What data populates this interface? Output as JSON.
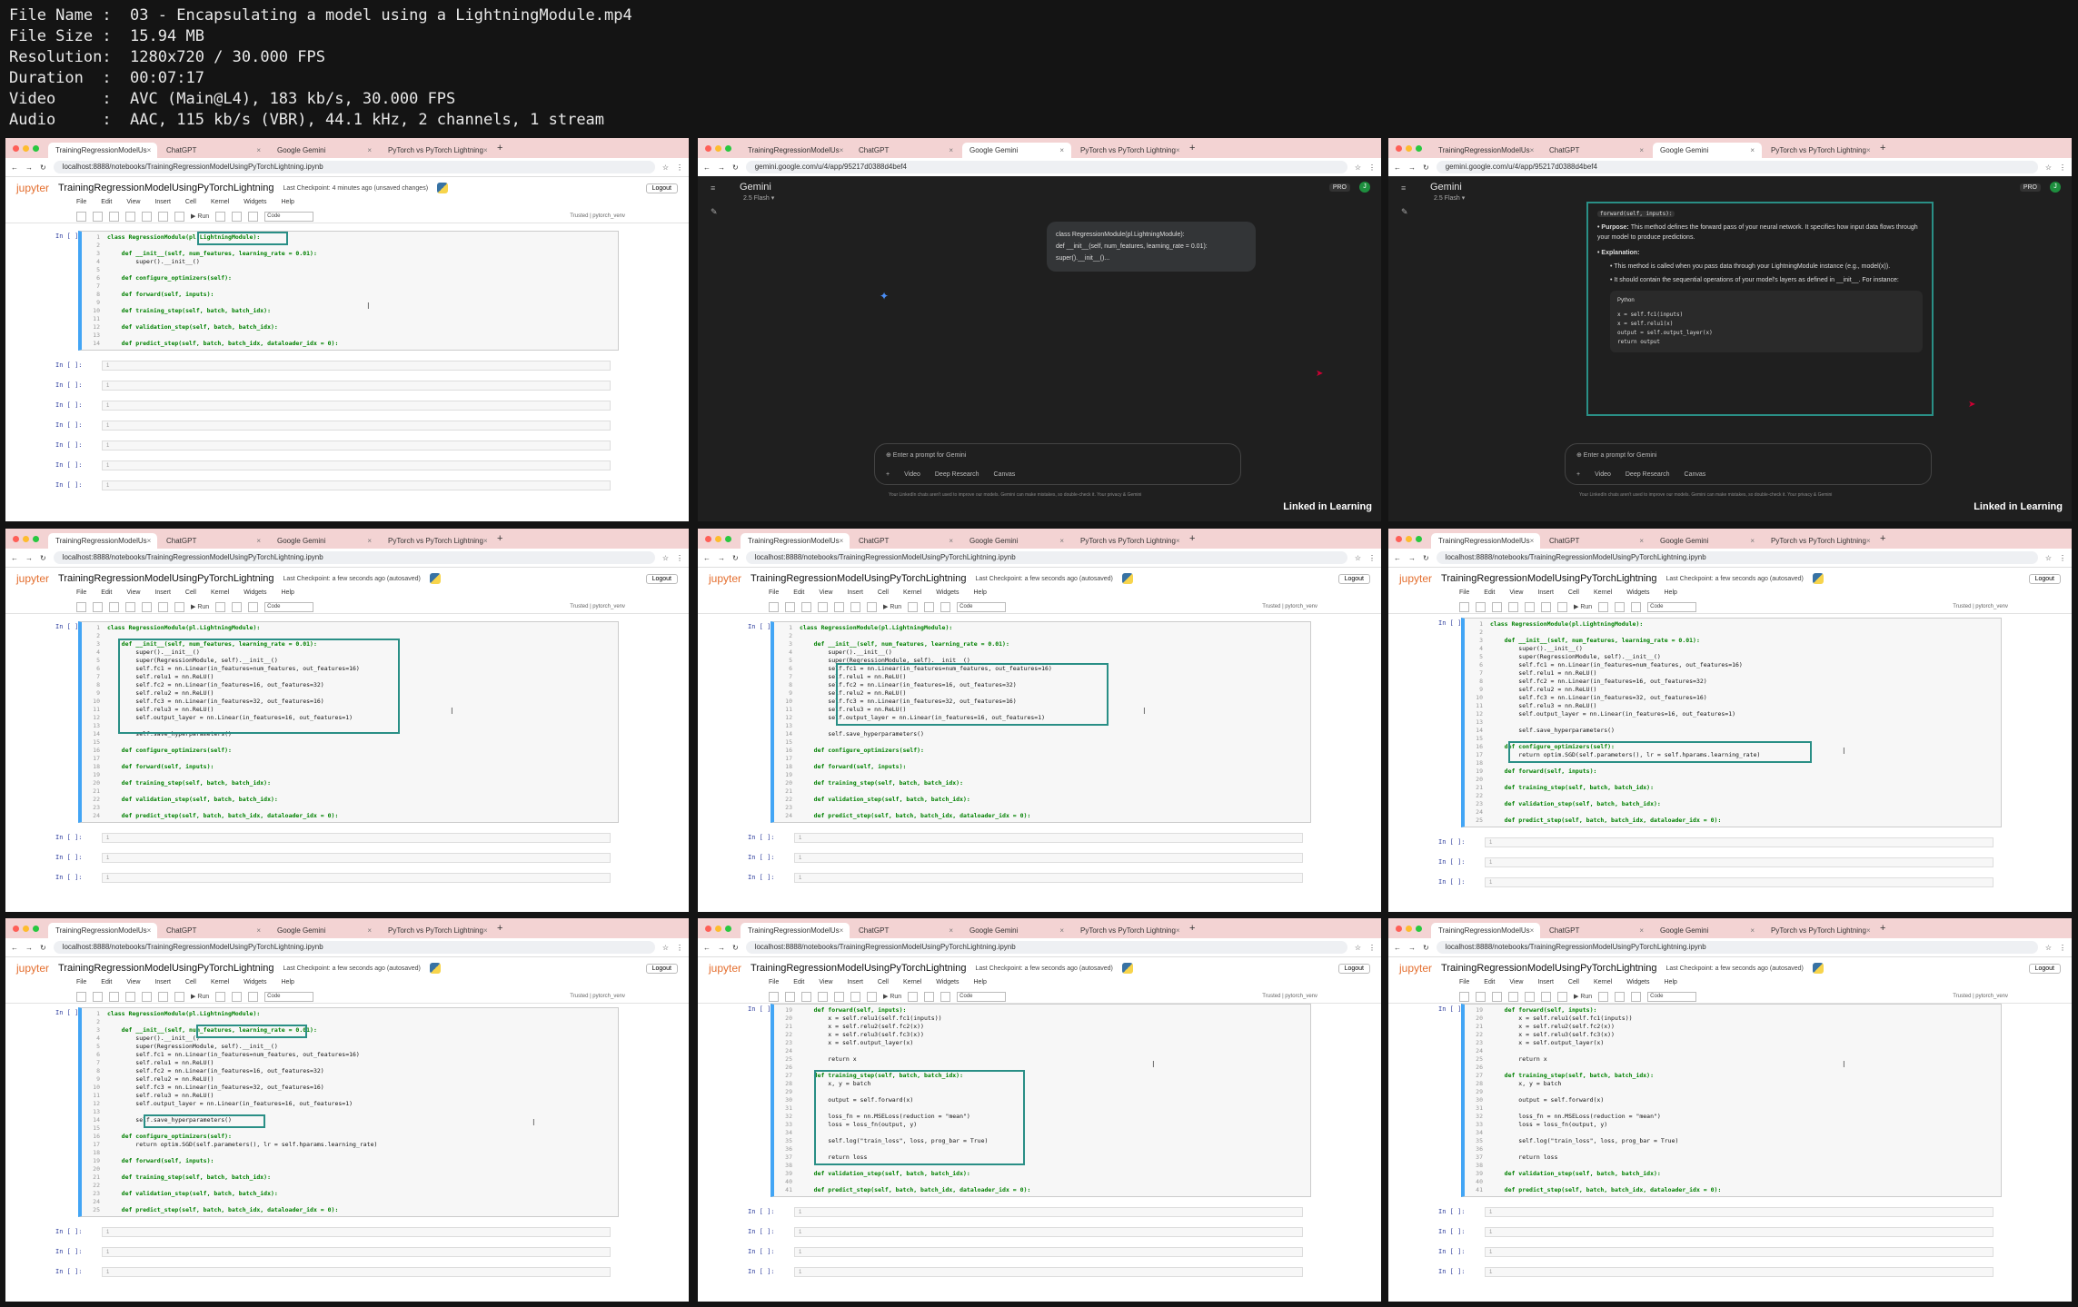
{
  "metadata": [
    {
      "label": "File Name",
      "value": "03 - Encapsulating a model using a LightningModule.mp4"
    },
    {
      "label": "File Size",
      "value": "15.94 MB"
    },
    {
      "label": "Resolution",
      "value": "1280x720 / 30.000 FPS"
    },
    {
      "label": "Duration",
      "value": "00:07:17"
    },
    {
      "label": "Video",
      "value": "AVC (Main@L4), 183 kb/s, 30.000 FPS"
    },
    {
      "label": "Audio",
      "value": "AAC, 115 kb/s (VBR), 44.1 kHz, 2 channels, 1 stream"
    }
  ],
  "browser": {
    "tabs": [
      "TrainingRegressionModelUs",
      "ChatGPT",
      "Google Gemini",
      "PyTorch vs PyTorch Lightning"
    ],
    "jupyter_url": "localhost:8888/notebooks/TrainingRegressionModelUsingPyTorchLightning.ipynb",
    "gemini_url": "gemini.google.com/u/4/app/95217d0388d4bef4"
  },
  "jupyter": {
    "logo": "jupyter",
    "notebook_title": "TrainingRegressionModelUsingPyTorchLightning",
    "checkpoint_first": "Last Checkpoint: 4 minutes ago  (unsaved changes)",
    "checkpoint_later": "Last Checkpoint: a few seconds ago  (autosaved)",
    "logout": "Logout",
    "menu": [
      "File",
      "Edit",
      "View",
      "Insert",
      "Cell",
      "Kernel",
      "Widgets",
      "Help"
    ],
    "run": "Run",
    "celltype": "Code",
    "trusted": "Trusted",
    "kernel": "pytorch_venv",
    "in_prompt": "In [ ]:"
  },
  "gemini": {
    "title": "Gemini",
    "model": "2.5 Flash",
    "pro": "PRO",
    "user_prompt": [
      "class RegressionModule(pl.LightningModule):",
      "def __init__(self, num_features, learning_rate = 0.01):",
      "super().__init__()..."
    ],
    "placeholder": "Enter a prompt for Gemini",
    "tools": [
      "Video",
      "Deep Research",
      "Canvas"
    ],
    "disclaimer": "Your LinkedIn chats aren't used to improve our models. Gemini can make mistakes, so double-check it. Your privacy & Gemini",
    "brand": "Linked in Learning",
    "answer": {
      "header": "forward(self, inputs):",
      "purpose_label": "Purpose:",
      "purpose": "This method defines the forward pass of your neural network. It specifies how input data flows through your model to produce predictions.",
      "explanation_label": "Explanation:",
      "bullet1": "This method is called when you pass data through your LightningModule instance (e.g., model(x)).",
      "bullet2": "It should contain the sequential operations of your model's layers as defined in __init__. For instance:",
      "lang": "Python",
      "code": [
        "x = self.fc1(inputs)",
        "x = self.relu1(x)",
        "output = self.output_layer(x)",
        "return output"
      ]
    }
  },
  "code": {
    "skeleton": [
      "class RegressionModule(pl.LightningModule):",
      "",
      "    def __init__(self, num_features, learning_rate = 0.01):",
      "        super().__init__()",
      "",
      "    def configure_optimizers(self):",
      "",
      "    def forward(self, inputs):",
      "",
      "    def training_step(self, batch, batch_idx):",
      "",
      "    def validation_step(self, batch, batch_idx):",
      "",
      "    def predict_step(self, batch, batch_idx, dataloader_idx = 0):"
    ],
    "init_full": [
      "class RegressionModule(pl.LightningModule):",
      "",
      "    def __init__(self, num_features, learning_rate = 0.01):",
      "        super().__init__()",
      "        super(RegressionModule, self).__init__()",
      "        self.fc1 = nn.Linear(in_features=num_features, out_features=16)",
      "        self.relu1 = nn.ReLU()",
      "        self.fc2 = nn.Linear(in_features=16, out_features=32)",
      "        self.relu2 = nn.ReLU()",
      "        self.fc3 = nn.Linear(in_features=32, out_features=16)",
      "        self.relu3 = nn.ReLU()",
      "        self.output_layer = nn.Linear(in_features=16, out_features=1)",
      "",
      "        self.save_hyperparameters()",
      "",
      "    def configure_optimizers(self):",
      "",
      "    def forward(self, inputs):",
      "",
      "    def training_step(self, batch, batch_idx):",
      "",
      "    def validation_step(self, batch, batch_idx):",
      "",
      "    def predict_step(self, batch, batch_idx, dataloader_idx = 0):"
    ],
    "with_optim": [
      "class RegressionModule(pl.LightningModule):",
      "",
      "    def __init__(self, num_features, learning_rate = 0.01):",
      "        super().__init__()",
      "        super(RegressionModule, self).__init__()",
      "        self.fc1 = nn.Linear(in_features=num_features, out_features=16)",
      "        self.relu1 = nn.ReLU()",
      "        self.fc2 = nn.Linear(in_features=16, out_features=32)",
      "        self.relu2 = nn.ReLU()",
      "        self.fc3 = nn.Linear(in_features=32, out_features=16)",
      "        self.relu3 = nn.ReLU()",
      "        self.output_layer = nn.Linear(in_features=16, out_features=1)",
      "",
      "        self.save_hyperparameters()",
      "",
      "    def configure_optimizers(self):",
      "        return optim.SGD(self.parameters(), lr = self.hparams.learning_rate)",
      "",
      "    def forward(self, inputs):",
      "",
      "    def training_step(self, batch, batch_idx):",
      "",
      "    def validation_step(self, batch, batch_idx):",
      "",
      "    def predict_step(self, batch, batch_idx, dataloader_idx = 0):"
    ],
    "training": [
      "    def forward(self, inputs):",
      "        x = self.relu1(self.fc1(inputs))",
      "        x = self.relu2(self.fc2(x))",
      "        x = self.relu3(self.fc3(x))",
      "        x = self.output_layer(x)",
      "",
      "        return x",
      "",
      "    def training_step(self, batch, batch_idx):",
      "        x, y = batch",
      "",
      "        output = self.forward(x)",
      "",
      "        loss_fn = nn.MSELoss(reduction = \"mean\")",
      "        loss = loss_fn(output, y)",
      "",
      "        self.log(\"train_loss\", loss, prog_bar = True)",
      "",
      "        return loss",
      "",
      "    def validation_step(self, batch, batch_idx):",
      "",
      "    def predict_step(self, batch, batch_idx, dataloader_idx = 0):"
    ]
  },
  "empty_cell_no": "1"
}
